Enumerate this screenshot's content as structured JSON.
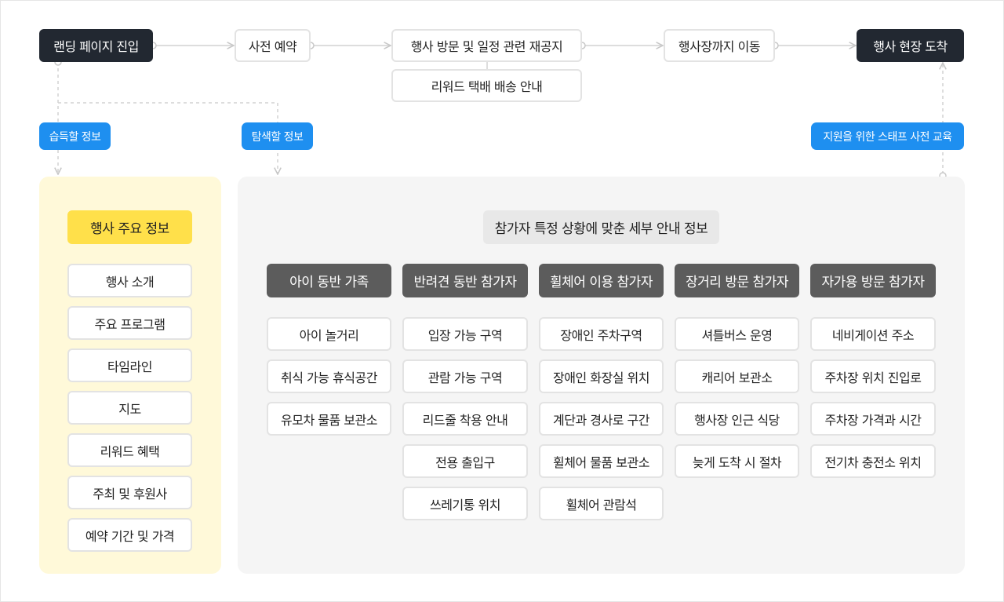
{
  "flow": {
    "landing": "랜딩 페이지 진입",
    "reservation": "사전 예약",
    "revisit": "행사 방문 및 일정 관련 재공지",
    "reward_delivery": "리워드 택배 배송 안내",
    "move": "행사장까지 이동",
    "arrival": "행사 현장 도착"
  },
  "labels": {
    "learn": "습득할 정보",
    "explore": "탐색할 정보",
    "staff": "지원을 위한 스태프 사전 교육"
  },
  "main_info": {
    "title": "행사 주요 정보",
    "items": [
      "행사 소개",
      "주요 프로그램",
      "타임라인",
      "지도",
      "리워드 혜택",
      "주최 및 후원사",
      "예약 기간 및 가격"
    ]
  },
  "detail": {
    "title": "참가자 특정 상황에 맞춘 세부 안내 정보",
    "columns": [
      {
        "head": "아이 동반 가족",
        "items": [
          "아이 놀거리",
          "취식 가능 휴식공간",
          "유모차 물품 보관소"
        ]
      },
      {
        "head": "반려견 동반 참가자",
        "items": [
          "입장 가능 구역",
          "관람 가능 구역",
          "리드줄 착용 안내",
          "전용 출입구",
          "쓰레기통 위치"
        ]
      },
      {
        "head": "휠체어 이용 참가자",
        "items": [
          "장애인 주차구역",
          "장애인 화장실 위치",
          "계단과 경사로 구간",
          "휠체어 물품 보관소",
          "휠체어 관람석"
        ]
      },
      {
        "head": "장거리 방문 참가자",
        "items": [
          "셔틀버스 운영",
          "캐리어 보관소",
          "행사장 인근 식당",
          "늦게 도착 시 절차"
        ]
      },
      {
        "head": "자가용 방문 참가자",
        "items": [
          "네비게이션 주소",
          "주차장 위치 진입로",
          "주차장 가격과 시간",
          "전기차 충전소 위치"
        ]
      }
    ]
  },
  "colors": {
    "dark_node": "#222831",
    "accent_blue": "#1e8ff0",
    "yellow": "#ffe04a",
    "yellow_panel": "#fff9d9",
    "column_head": "#5c5c5c"
  }
}
